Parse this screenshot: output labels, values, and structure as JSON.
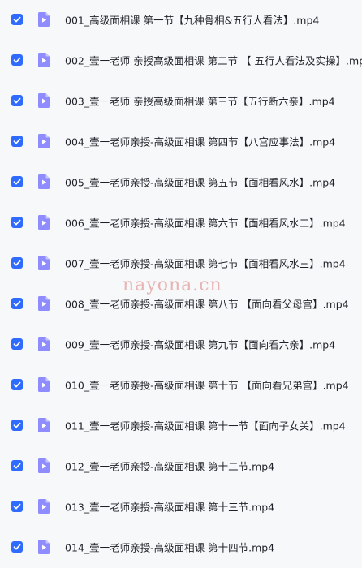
{
  "files": [
    {
      "name": "001_高级面相课 第一节【九种骨相&五行人看法】.mp4",
      "checked": true
    },
    {
      "name": "002_壹一老师 亲授高级面相课 第二节 【 五行人看法及实操】.mp4",
      "checked": true
    },
    {
      "name": "003_壹一老师 亲授高级面相课 第三节【五行断六亲】.mp4",
      "checked": true
    },
    {
      "name": "004_壹一老师亲授-高级面相课 第四节【八宫应事法】.mp4",
      "checked": true
    },
    {
      "name": "005_壹一老师亲授-高级面相课 第五节【面相看风水】.mp4",
      "checked": true
    },
    {
      "name": "006_壹一老师亲授-高级面相课 第六节【面相看风水二】.mp4",
      "checked": true
    },
    {
      "name": "007_壹一老师亲授-高级面相课 第七节【面相看风水三】.mp4",
      "checked": true
    },
    {
      "name": "008_壹一老师亲授-高级面相课 第八节 【面向看父母宫】.mp4",
      "checked": true
    },
    {
      "name": "009_壹一老师亲授-高级面相课 第九节【面向看六亲】.mp4",
      "checked": true
    },
    {
      "name": "010_壹一老师亲授-高级面相课 第十节 【面向看兄弟宫】.mp4",
      "checked": true
    },
    {
      "name": "011_壹一老师亲授-高级面相课 第十一节【面向子女关】.mp4",
      "checked": true
    },
    {
      "name": "012_壹一老师亲授-高级面相课 第十二节.mp4",
      "checked": true
    },
    {
      "name": "013_壹一老师亲授-高级面相课 第十三节.mp4",
      "checked": true
    },
    {
      "name": "014_壹一老师亲授-高级面相课 第十四节.mp4",
      "checked": true
    }
  ],
  "watermark": "nayona.cn",
  "colors": {
    "checkbox": "#2f6bff",
    "video_icon_body": "#8f8cff",
    "video_icon_fold": "#c8c6ff",
    "text": "#1f2329",
    "background": "#f7f8fa"
  },
  "icons": {
    "checkbox": "checkmark-icon",
    "file": "video-file-icon"
  }
}
